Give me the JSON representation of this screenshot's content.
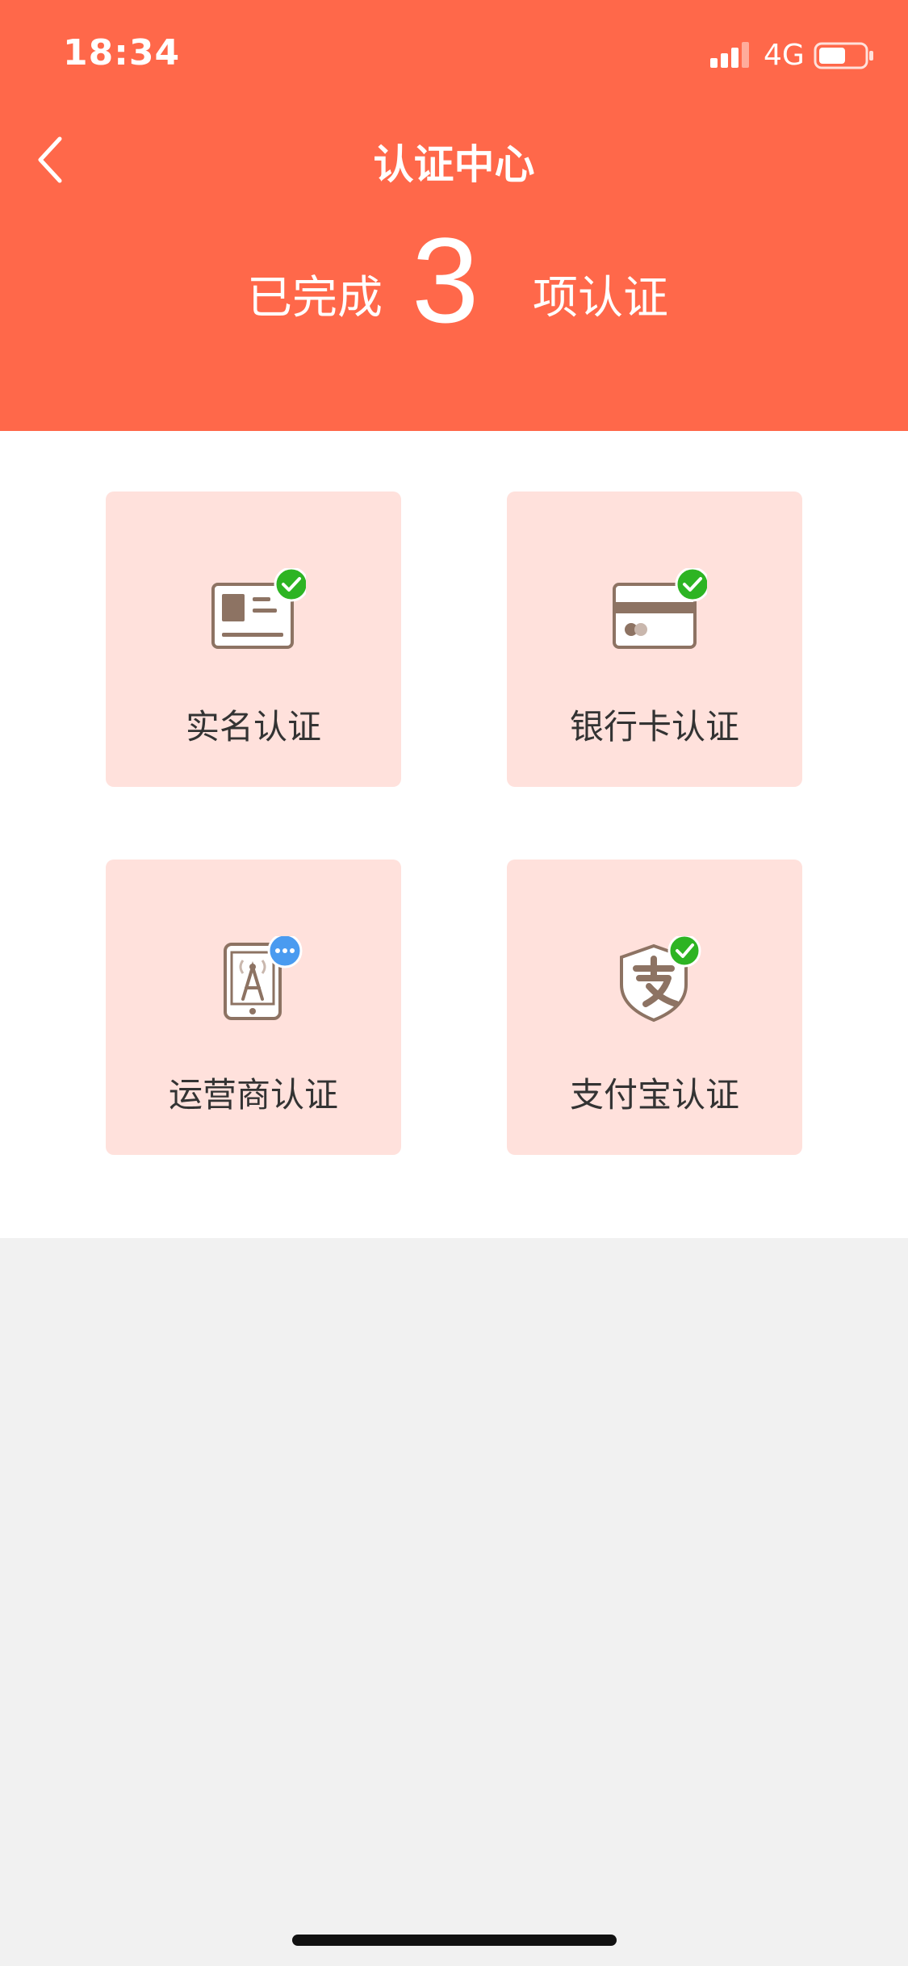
{
  "status_bar": {
    "time": "18:34",
    "network": "4G"
  },
  "nav": {
    "title": "认证中心"
  },
  "summary": {
    "prefix": "已完成",
    "count": "3",
    "suffix": "项认证"
  },
  "cards": [
    {
      "label": "实名认证",
      "icon": "id-card-icon",
      "status": "verified"
    },
    {
      "label": "银行卡认证",
      "icon": "bank-card-icon",
      "status": "verified"
    },
    {
      "label": "运营商认证",
      "icon": "mobile-carrier-icon",
      "status": "pending"
    },
    {
      "label": "支付宝认证",
      "icon": "alipay-icon",
      "status": "verified"
    }
  ],
  "colors": {
    "header": "#ff684a",
    "card": "#ffe1dc",
    "icon": "#8d7363",
    "verified": "#2db423",
    "pending": "#4a9bf0"
  }
}
